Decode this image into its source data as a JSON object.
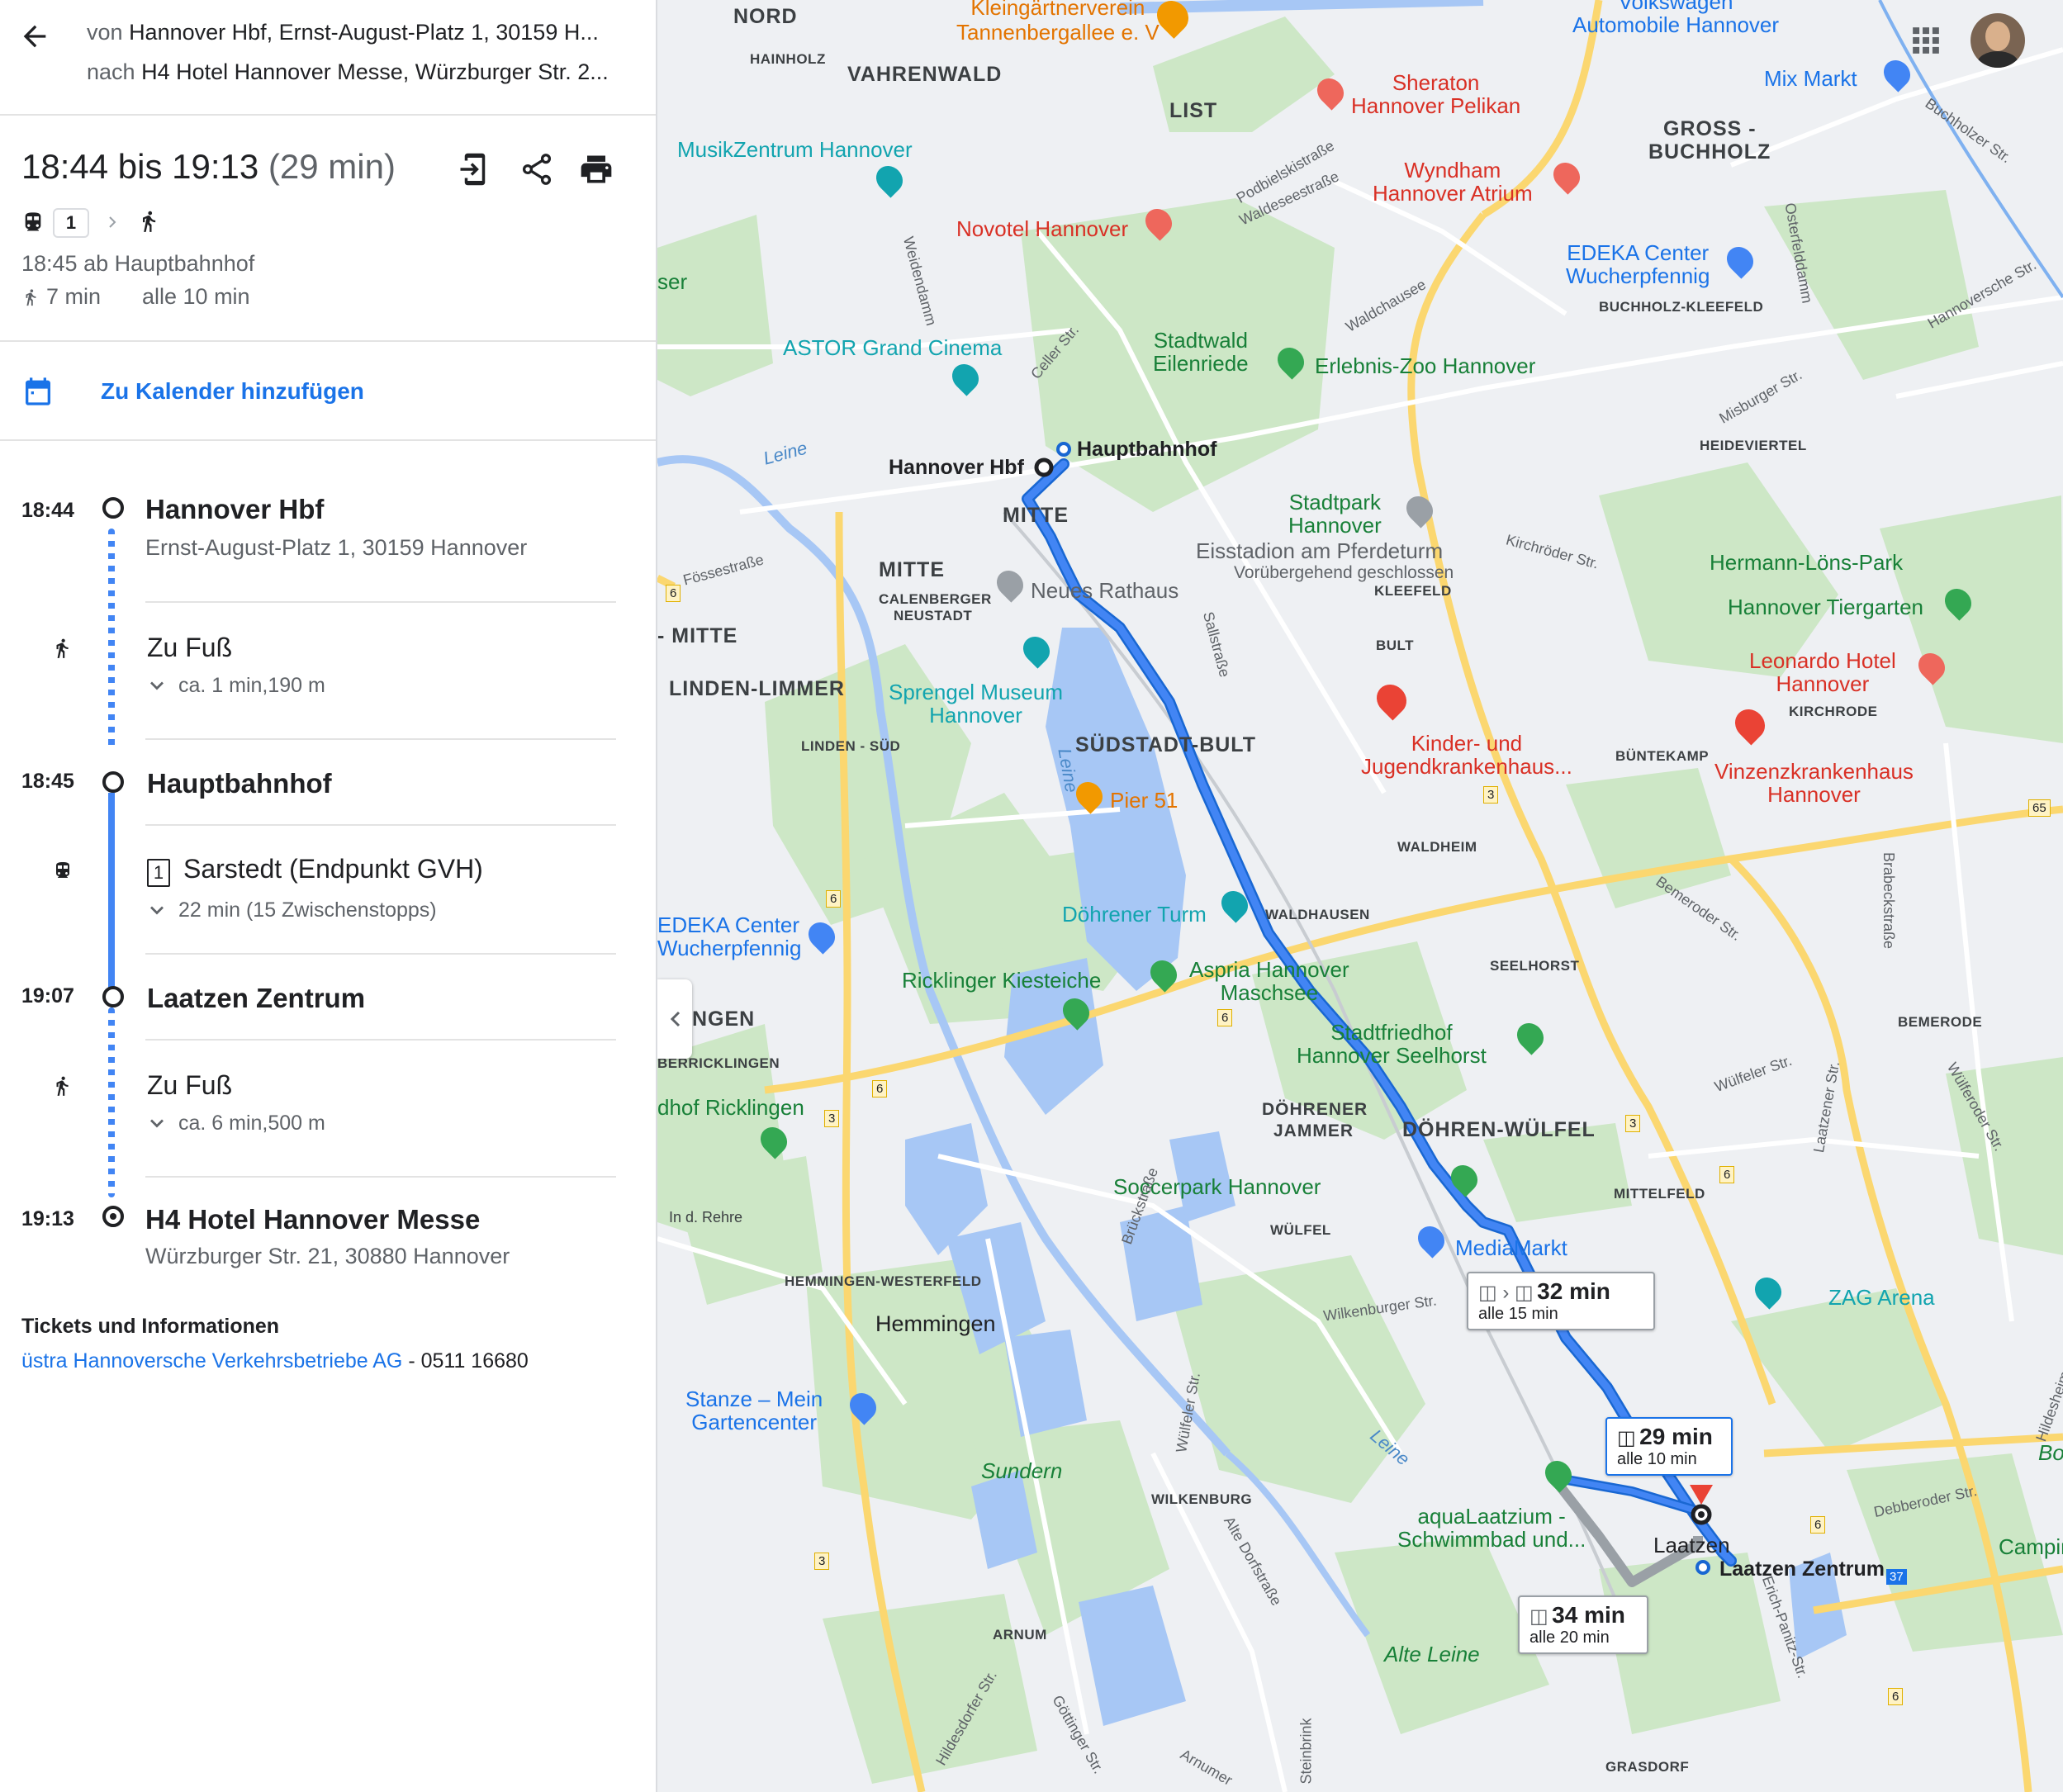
{
  "header": {
    "from_prefix": "von",
    "from_text": "Hannover Hbf, Ernst-August-Platz 1, 30159 H...",
    "to_prefix": "nach",
    "to_text": "H4 Hotel Hannover Messe, Würzburger Str. 2..."
  },
  "summary": {
    "time_range": "18:44 bis 19:13",
    "duration": "(29 min)",
    "line_badge": "1",
    "departure": "18:45 ab Hauptbahnhof",
    "walk": "7 min",
    "frequency": "alle 10 min"
  },
  "calendar_link": "Zu Kalender hinzufügen",
  "steps": {
    "start_time": "18:44",
    "start_name": "Hannover Hbf",
    "start_addr": "Ernst-August-Platz 1, 30159 Hannover",
    "walk1_title": "Zu Fuß",
    "walk1_sub": "ca. 1 min,190 m",
    "board_time": "18:45",
    "board_name": "Hauptbahnhof",
    "transit_badge": "1",
    "transit_title": "Sarstedt (Endpunkt GVH)",
    "transit_sub": "22 min (15 Zwischenstopps)",
    "alight_time": "19:07",
    "alight_name": "Laatzen Zentrum",
    "walk2_title": "Zu Fuß",
    "walk2_sub": "ca. 6 min,500 m",
    "end_time": "19:13",
    "end_name": "H4 Hotel Hannover Messe",
    "end_addr": "Würzburger Str. 21, 30880 Hannover"
  },
  "tickets": {
    "heading": "Tickets und Informationen",
    "link": "üstra Hannoversche Verkehrsbetriebe AG",
    "phone": " - 0511 16680"
  },
  "map": {
    "districts": [
      "NORD",
      "VAHRENWALD",
      "LIST",
      "GROSS -",
      "BUCHHOLZ",
      "MITTE",
      "MITTE",
      "SÜDSTADT-BULT",
      "LINDEN-LIMMER",
      "- MITTE",
      "DÖHREN-WÜLFEL",
      "Hemmingen",
      "NGEN"
    ],
    "minor_labels": [
      "HAINHOLZ",
      "BUCHHOLZ-KLEEFELD",
      "HEIDEVIERTEL",
      "KLEEFELD",
      "BULT",
      "CALENBERGER",
      "NEUSTADT",
      "LINDEN - SÜD",
      "WALDHEIM",
      "WALDHAUSEN",
      "SEELHORST",
      "KIRCHRODE",
      "BÜNTEKAMP",
      "BEMERODE",
      "DÖHRENER",
      "JAMMER",
      "MITTELFELD",
      "WÜLFEL",
      "HEMMINGEN-WESTERFELD",
      "WILKENBURG",
      "ARNUM",
      "GRASDORF",
      "BERRICKLINGEN",
      "In d. Rehre"
    ],
    "pois": {
      "klein1": "Kleingärtnerverein",
      "klein2": "Tannenbergallee e. V",
      "vw1": "Volkswagen",
      "vw2": "Automobile Hannover",
      "mix": "Mix Markt",
      "sheraton1": "Sheraton",
      "sheraton2": "Hannover Pelikan",
      "musikzentrum": "MusikZentrum Hannover",
      "wyndham1": "Wyndham",
      "wyndham2": "Hannover Atrium",
      "novotel": "Novotel Hannover",
      "edeka1a": "EDEKA Center",
      "edeka1b": "Wucherpfennig",
      "astor": "ASTOR Grand Cinema",
      "stadtwald1": "Stadtwald",
      "stadtwald2": "Eilenriede",
      "zoo": "Erlebnis-Zoo Hannover",
      "hbf_map": "Hannover Hbf",
      "hauptbahnhof_map": "Hauptbahnhof",
      "stadtpark1": "Stadtpark",
      "stadtpark2": "Hannover",
      "eisstadion": "Eisstadion am Pferdeturm",
      "eisstadion_sub": "Vorübergehend geschlossen",
      "rathaus": "Neues Rathaus",
      "loens": "Hermann-Löns-Park",
      "tiergarten": "Hannover Tiergarten",
      "sprengel1": "Sprengel Museum",
      "sprengel2": "Hannover",
      "leonardo1": "Leonardo Hotel",
      "leonardo2": "Hannover",
      "kinder1": "Kinder- und",
      "kinder2": "Jugendkrankenhaus...",
      "vinzenz1": "Vinzenzkrankenhaus",
      "vinzenz2": "Hannover",
      "pier": "Pier 51",
      "doehrener_turm": "Döhrener Turm",
      "edeka2a": "EDEKA Center",
      "edeka2b": "Wucherpfennig",
      "ricklinger": "Ricklinger Kiesteiche",
      "aspria1": "Aspria Hannover",
      "aspria2": "Maschsee",
      "stadtfriedhof1": "Stadtfriedhof",
      "stadtfriedhof2": "Hannover Seelhorst",
      "friedhof_ricklingen": "dhof Ricklingen",
      "soccerpark": "Soccerpark Hannover",
      "mediamarkt": "MediaMarkt",
      "zag": "ZAG Arena",
      "stanze1": "Stanze – Mein",
      "stanze2": "Gartencenter",
      "aqua1": "aquaLaatzium -",
      "aqua2": "Schwimmbad und...",
      "laatzen": "Laatzen",
      "laatzen_zentrum": "Laatzen Zentrum",
      "camping": "Camping",
      "ser": "ser",
      "bo": "Bo"
    },
    "streets": [
      "Podbielskistraße",
      "Waldeseestraße",
      "Weidendamm",
      "Celler Str.",
      "Waldchausee",
      "Misburger Str.",
      "Kirchröder Str.",
      "Fössestraße",
      "Sallstraße",
      "Bemeroder Str.",
      "Brabeckstraße",
      "Wülfeler Str.",
      "Laatzener Str.",
      "Wilkenburger Str.",
      "Brückstraße",
      "Hildesheimer Str.",
      "Wülfeler Str.",
      "Alte Dorfstraße",
      "Erich-Panitz-Str.",
      "Göttinger Str.",
      "Hildesdorfer Str.",
      "Debberoder Str.",
      "Steinbrink",
      "Buchholzer Str.",
      "Hannoversche Str.",
      "Osterfelddamm",
      "Wülferoder Str.",
      "Arnumer"
    ],
    "water": [
      "Leine",
      "Leine",
      "Leine",
      "Sundern",
      "Alte Leine"
    ],
    "road_numbers": [
      "6",
      "6",
      "6",
      "6",
      "6",
      "6",
      "3",
      "3",
      "3",
      "3",
      "65",
      "37",
      "6"
    ],
    "route_labels": {
      "r1_time": "32 min",
      "r1_freq": "alle 15 min",
      "r2_time": "29 min",
      "r2_freq": "alle 10 min",
      "r3_time": "34 min",
      "r3_freq": "alle 20 min"
    },
    "colors": {
      "route": "#4285f4",
      "route_alt": "#9aa0a6",
      "park": "#c8e6c4",
      "water": "#aecbfa",
      "road_yellow": "#fde293"
    }
  },
  "icons": [
    "back-arrow-icon",
    "send-to-phone-icon",
    "share-icon",
    "print-icon",
    "tram-icon",
    "chevron-right-icon",
    "walk-icon",
    "calendar-icon",
    "chevron-down-icon",
    "apps-grid-icon",
    "avatar",
    "collapse-panel-icon",
    "destination-pin-icon"
  ]
}
